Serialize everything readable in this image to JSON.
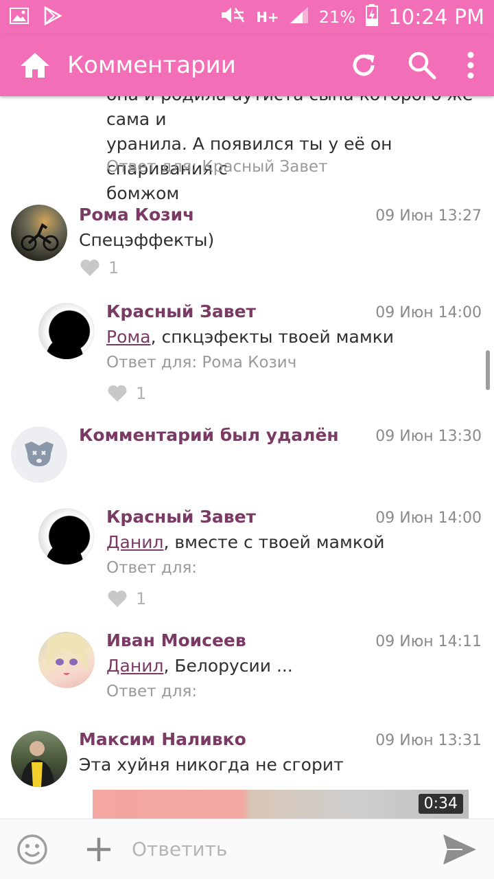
{
  "status_bar": {
    "network": "H+",
    "battery": "21%",
    "time": "10:24 PM"
  },
  "app_bar": {
    "title": "Комментарии",
    "icons": [
      "home-icon",
      "refresh-icon",
      "search-icon",
      "more-vert-icon"
    ]
  },
  "comments": [
    {
      "text_lines": [
        "она и родила аутиста сына которого же сама и",
        "уранила. А появился ты у её он спаривания с",
        "бомжом"
      ],
      "reply_for": "Ответ для: Красный Завет"
    },
    {
      "name": "Рома Козич",
      "date": "09 Июн 13:27",
      "text": "Спецэффекты)",
      "likes": "1"
    },
    {
      "name": "Красный Завет",
      "date": "09 Июн 14:00",
      "mention": "Рома",
      "text": ", спкцэфекты твоей мамки",
      "reply_for": "Ответ для: Рома Козич",
      "likes": "1"
    },
    {
      "name": "Комментарий был удалён",
      "date": "09 Июн 13:30"
    },
    {
      "name": "Красный Завет",
      "date": "09 Июн 14:00",
      "mention": "Данил",
      "text": ", вместе с твоей мамкой",
      "reply_for": "Ответ для:",
      "likes": "1"
    },
    {
      "name": "Иван Моисеев",
      "date": "09 Июн 14:11",
      "mention": "Данил",
      "text": ",  Белорусии ...",
      "reply_for": "Ответ для:"
    },
    {
      "name": "Максим Наливко",
      "date": "09 Июн 13:31",
      "text": "Эта хуйня никогда не сгорит",
      "video_duration": "0:34"
    }
  ],
  "bottom_bar": {
    "placeholder": "Ответить"
  }
}
